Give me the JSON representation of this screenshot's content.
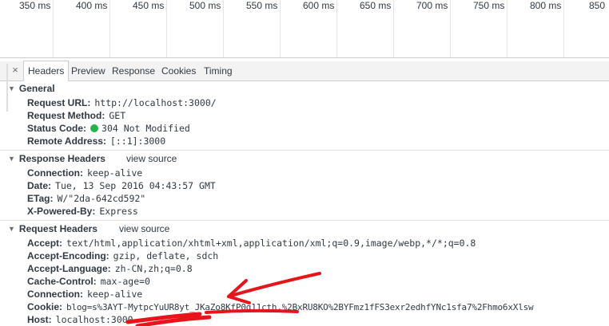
{
  "timeline": {
    "ticks": [
      "350 ms",
      "400 ms",
      "450 ms",
      "500 ms",
      "550 ms",
      "600 ms",
      "650 ms",
      "700 ms",
      "750 ms",
      "800 ms",
      "850"
    ]
  },
  "tabs": {
    "close": "×",
    "items": [
      "Headers",
      "Preview",
      "Response",
      "Cookies",
      "Timing"
    ],
    "active": "Headers"
  },
  "general": {
    "title": "General",
    "rows": [
      {
        "key": "Request URL:",
        "value": "http://localhost:3000/"
      },
      {
        "key": "Request Method:",
        "value": "GET"
      },
      {
        "key": "Status Code:",
        "value": "304 Not Modified"
      },
      {
        "key": "Remote Address:",
        "value": "[::1]:3000"
      }
    ]
  },
  "response_headers": {
    "title": "Response Headers",
    "view_source": "view source",
    "rows": [
      {
        "key": "Connection:",
        "value": "keep-alive"
      },
      {
        "key": "Date:",
        "value": "Tue, 13 Sep 2016 04:43:57 GMT"
      },
      {
        "key": "ETag:",
        "value": "W/\"2da-642cd592\""
      },
      {
        "key": "X-Powered-By:",
        "value": "Express"
      }
    ]
  },
  "request_headers": {
    "title": "Request Headers",
    "view_source": "view source",
    "rows": [
      {
        "key": "Accept:",
        "value": "text/html,application/xhtml+xml,application/xml;q=0.9,image/webp,*/*;q=0.8"
      },
      {
        "key": "Accept-Encoding:",
        "value": "gzip, deflate, sdch"
      },
      {
        "key": "Accept-Language:",
        "value": "zh-CN,zh;q=0.8"
      },
      {
        "key": "Cache-Control:",
        "value": "max-age=0"
      },
      {
        "key": "Connection:",
        "value": "keep-alive"
      },
      {
        "key": "Cookie:",
        "value": "blog=s%3AYT-MytpcYuUR8yt_JKaZo8KfP0g11cth.%2BxRU8KO%2BYFmz1fFS3exr2edhfYNc1sfa7%2Fhmo6xXlsw"
      },
      {
        "key": "Host:",
        "value": "localhost:3000"
      }
    ]
  },
  "annotation": {
    "arrow_color": "#e8141c"
  }
}
